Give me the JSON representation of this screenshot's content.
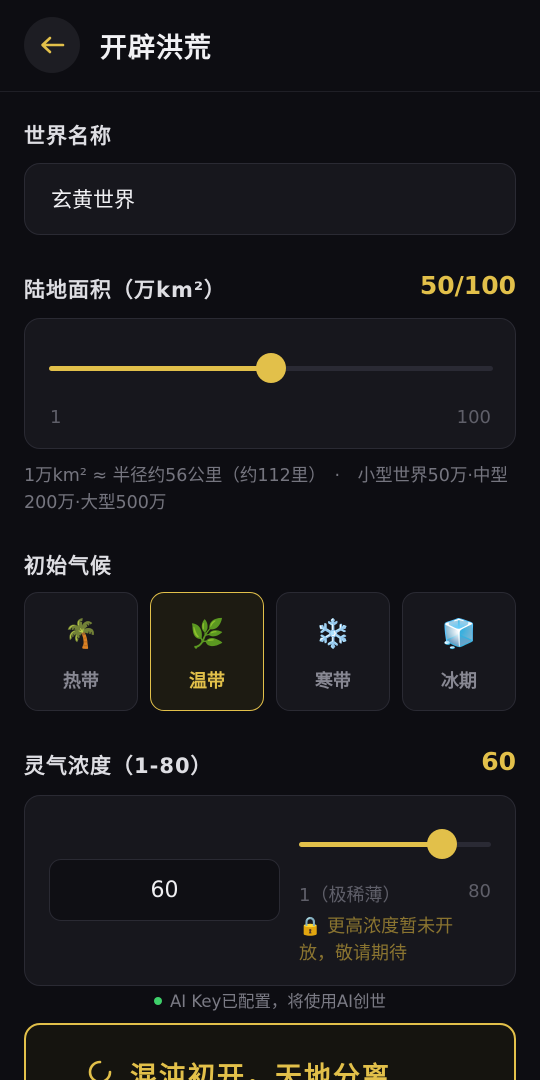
{
  "header": {
    "title": "开辟洪荒"
  },
  "world_name": {
    "label": "世界名称",
    "value": "玄黄世界"
  },
  "land_area": {
    "label": "陆地面积（万km²）",
    "value_display": "50/100",
    "value": 50,
    "min": 1,
    "max": 100,
    "min_label": "1",
    "max_label": "100",
    "hint": "1万km² ≈ 半径约56公里（约112里）　·　小型世界50万·中型200万·大型500万"
  },
  "climate": {
    "label": "初始气候",
    "selected": "温带",
    "options": [
      {
        "emoji": "🌴",
        "label": "热带",
        "icon": "palm-tree-icon"
      },
      {
        "emoji": "🌿",
        "label": "温带",
        "icon": "herb-icon"
      },
      {
        "emoji": "❄️",
        "label": "寒带",
        "icon": "snowflake-icon"
      },
      {
        "emoji": "🧊",
        "label": "冰期",
        "icon": "ice-cube-icon"
      }
    ]
  },
  "spirit": {
    "label": "灵气浓度（1-80）",
    "value_display": "60",
    "value": 60,
    "min": 1,
    "max": 80,
    "input_value": "60",
    "min_label": "1（极稀薄）",
    "max_label": "80",
    "warning": "🔒 更高浓度暂未开放，敬请期待"
  },
  "status": {
    "text": "AI Key已配置，将使用AI创世"
  },
  "action": {
    "label": "混沌初开，天地分离..."
  },
  "colors": {
    "accent": "#e2c04a",
    "background": "#0d0d12",
    "card": "#17171d",
    "status_ok": "#3ecf6a"
  }
}
